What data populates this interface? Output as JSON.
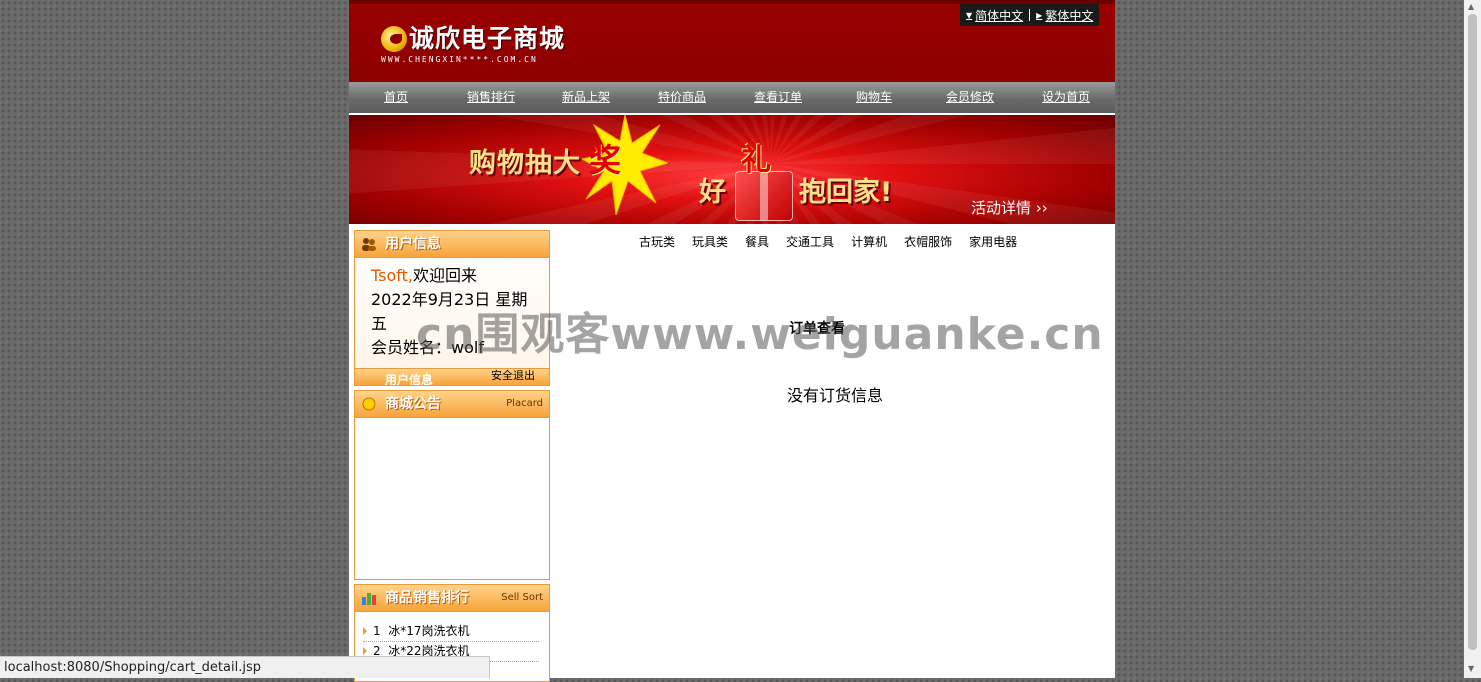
{
  "header": {
    "logo_cn": "诚欣电子商城",
    "logo_en": "WWW.CHENGXIN****.COM.CN",
    "lang_simplified": "简体中文",
    "lang_traditional": "繁体中文"
  },
  "nav": {
    "items": [
      "首页",
      "销售排行",
      "新品上架",
      "特价商品",
      "查看订单",
      "购物车",
      "会员修改",
      "设为首页"
    ]
  },
  "banner": {
    "text1": "购物抽大",
    "text1_big": "奖",
    "text2a": "好",
    "gift_char": "礼",
    "text2b": "抱回家!",
    "detail": "活动详情 ››"
  },
  "user_box": {
    "title": "用户信息",
    "username": "Tsoft,",
    "welcome": "欢迎回来",
    "date": "2022年9月23日 星期五",
    "member_label": "会员姓名：wolf",
    "footer_ghost": "用户信息",
    "logout": "安全退出"
  },
  "notice_box": {
    "title": "商城公告",
    "title_en": "Placard"
  },
  "rank_box": {
    "title": "商品销售排行",
    "title_en": "Sell Sort",
    "items": [
      {
        "rank": "1",
        "name": "冰*17岗洗衣机"
      },
      {
        "rank": "2",
        "name": "冰*22岗洗衣机"
      }
    ]
  },
  "main": {
    "categories": [
      "古玩类",
      "玩具类",
      "餐具",
      "交通工具",
      "计算机",
      "衣帽服饰",
      "家用电器"
    ],
    "section_title": "订单查看",
    "empty_message": "没有订货信息"
  },
  "watermark": "cn围观客www.weiguanke.cn",
  "status_url": "localhost:8080/Shopping/cart_detail.jsp",
  "colors": {
    "header_red": "#8c0000",
    "accent_orange": "#f6a43a",
    "username_orange": "#e05a00"
  }
}
